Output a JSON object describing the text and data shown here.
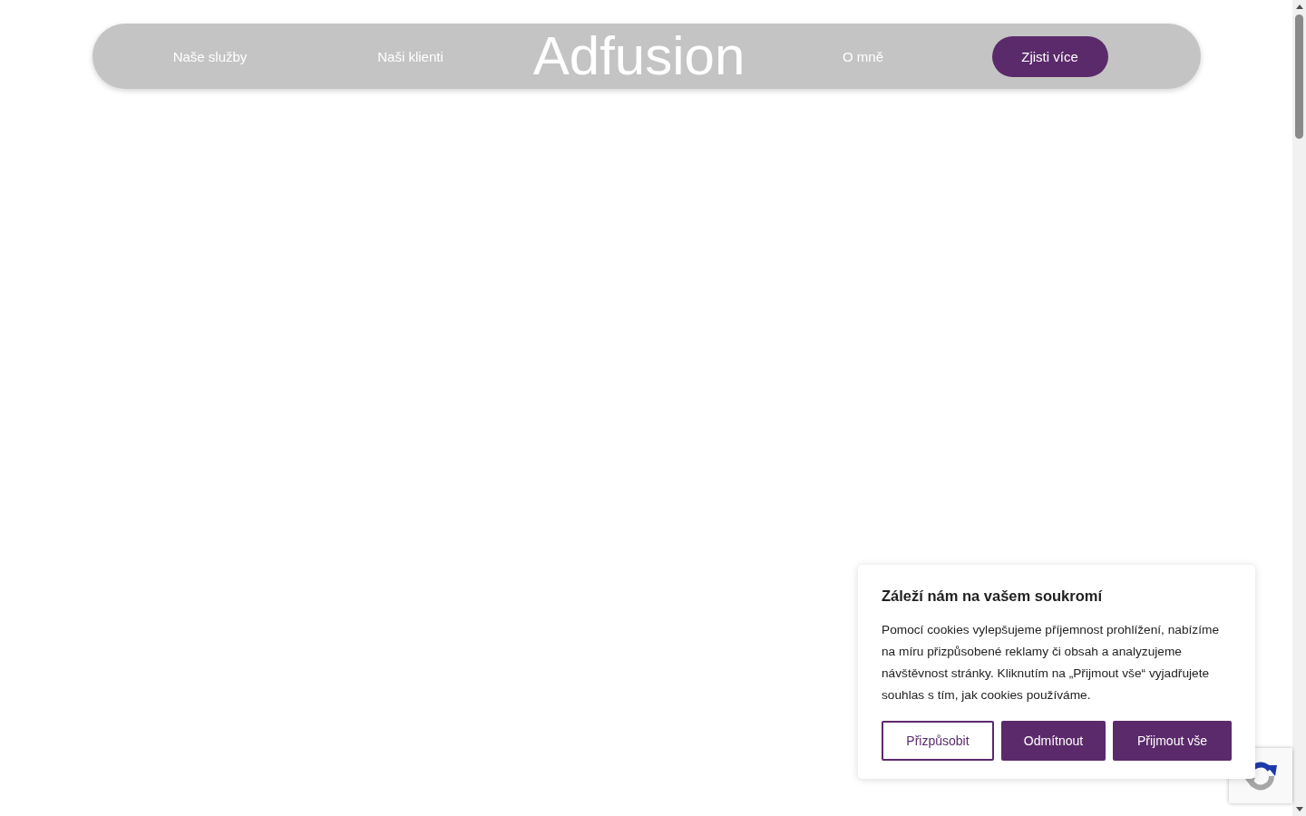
{
  "nav": {
    "items": [
      {
        "kind": "link",
        "label": "Naše služby"
      },
      {
        "kind": "link",
        "label": "Naši klienti"
      },
      {
        "kind": "logo",
        "label": "Adfusion"
      },
      {
        "kind": "link",
        "label": "O mně"
      },
      {
        "kind": "button",
        "label": "Zjisti více"
      }
    ]
  },
  "cookie_dialog": {
    "title": "Záleží nám na vašem soukromí",
    "text": "Pomocí cookies vylepšujeme příjemnost prohlížení, nabízíme na míru přizpůsobené reklamy či obsah a analyzujeme návštěvnost stránky. Kliknutím na „Přijmout vše“ vyjadřujete souhlas s tím, jak cookies používáme.",
    "buttons": [
      {
        "kind": "outline",
        "label": "Přizpůsobit"
      },
      {
        "kind": "filled",
        "label": "Odmítnout"
      },
      {
        "kind": "filled",
        "label": "Přijmout vše"
      }
    ]
  }
}
